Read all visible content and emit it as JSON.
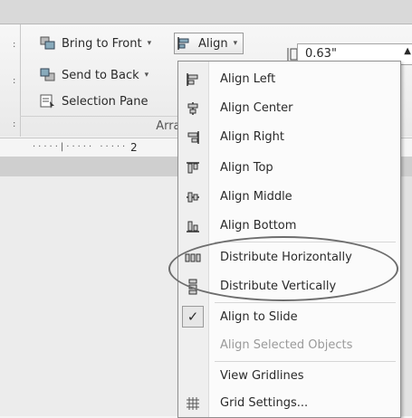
{
  "ribbon": {
    "bring_to_front": "Bring to Front",
    "send_to_back": "Send to Back",
    "selection_pane": "Selection Pane",
    "align": "Align",
    "group_label": "Arrange",
    "height_value": "0.63\""
  },
  "ruler": {
    "number": "2"
  },
  "menu": {
    "items": [
      {
        "label": "Align Left",
        "icon": "align-left-icon"
      },
      {
        "label": "Align Center",
        "icon": "align-center-icon"
      },
      {
        "label": "Align Right",
        "icon": "align-right-icon"
      },
      {
        "label": "Align Top",
        "icon": "align-top-icon"
      },
      {
        "label": "Align Middle",
        "icon": "align-middle-icon"
      },
      {
        "label": "Align Bottom",
        "icon": "align-bottom-icon"
      },
      {
        "label": "Distribute Horizontally",
        "icon": "distribute-horizontally-icon"
      },
      {
        "label": "Distribute Vertically",
        "icon": "distribute-vertically-icon"
      },
      {
        "label": "Align to Slide",
        "icon": "checkmark-icon",
        "checked": true
      },
      {
        "label": "Align Selected Objects",
        "icon": "",
        "disabled": true
      },
      {
        "label": "View Gridlines",
        "icon": ""
      },
      {
        "label": "Grid Settings...",
        "icon": "grid-icon"
      }
    ]
  }
}
